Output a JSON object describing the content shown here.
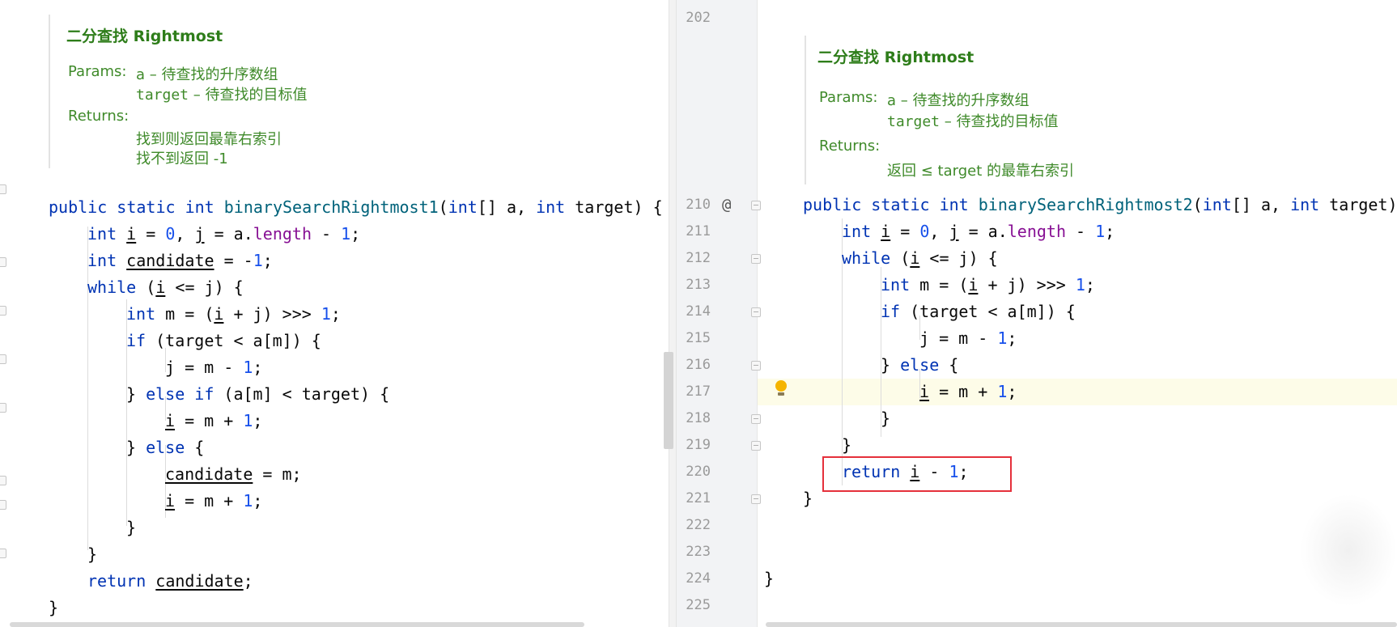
{
  "left": {
    "doc": {
      "title": "二分查找 Rightmost",
      "params_label": "Params:",
      "param_a_name": "a",
      "param_a_desc": " – 待查找的升序数组",
      "param_target_name": "target",
      "param_target_desc": " – 待查找的目标值",
      "returns_label": "Returns:",
      "returns_line1": "找到则返回最靠右索引",
      "returns_line2": "找不到返回 -1"
    },
    "code": {
      "l1": {
        "kw1": "public static int ",
        "fn": "binarySearchRightmost1",
        "p1": "(",
        "kw2": "int",
        "p2": "[] a, ",
        "kw3": "int",
        "p3": " target) {"
      },
      "l2": {
        "kw": "int ",
        "v1": "i",
        "p1": " = ",
        "n1": "0",
        "p2": ", ",
        "v2": "j",
        "p3": " = a.",
        "fld": "length",
        "p4": " - ",
        "n2": "1",
        "p5": ";"
      },
      "l3": {
        "kw": "int ",
        "v": "candidate",
        "p1": " = -",
        "n": "1",
        "p2": ";"
      },
      "l4": {
        "kw": "while",
        "p1": " (",
        "v": "i",
        "p2": " <= j) {"
      },
      "l5": {
        "kw": "int",
        "p1": " m = (",
        "v": "i",
        "p2": " + j) >>> ",
        "n": "1",
        "p3": ";"
      },
      "l6": {
        "kw": "if",
        "p1": " (target < a[m]) {"
      },
      "l7": {
        "p1": "j = m - ",
        "n": "1",
        "p2": ";"
      },
      "l8": {
        "p1": "} ",
        "kw": "else if",
        "p2": " (a[m] < target) {"
      },
      "l9": {
        "v": "i",
        "p1": " = m + ",
        "n": "1",
        "p2": ";"
      },
      "l10": {
        "p1": "} ",
        "kw": "else",
        "p2": " {"
      },
      "l11": {
        "v": "candidate",
        "p1": " = m;"
      },
      "l12": {
        "v": "i",
        "p1": " = m + ",
        "n": "1",
        "p2": ";"
      },
      "l13": {
        "p1": "}"
      },
      "l14": {
        "p1": "}"
      },
      "l15": {
        "kw": "return ",
        "v": "candidate",
        "p1": ";"
      },
      "l16": {
        "p1": "}"
      }
    }
  },
  "right": {
    "line_numbers": [
      "202",
      "210",
      "211",
      "212",
      "213",
      "214",
      "215",
      "216",
      "217",
      "218",
      "219",
      "220",
      "221",
      "222",
      "223",
      "224",
      "225"
    ],
    "override_marker": "@",
    "doc": {
      "title": "二分查找 Rightmost",
      "params_label": "Params:",
      "param_a_name": "a",
      "param_a_desc": " – 待查找的升序数组",
      "param_target_name": "target",
      "param_target_desc": " – 待查找的目标值",
      "returns_label": "Returns:",
      "returns_line1": "返回 ≤ target 的最靠右索引"
    },
    "code": {
      "l210": {
        "kw1": "public static int ",
        "fn": "binarySearchRightmost2",
        "p1": "(",
        "kw2": "int",
        "p2": "[] a, ",
        "kw3": "int",
        "p3": " target) {"
      },
      "l211": {
        "kw": "int ",
        "v1": "i",
        "p1": " = ",
        "n1": "0",
        "p2": ", ",
        "v2": "j",
        "p3": " = a.",
        "fld": "length",
        "p4": " - ",
        "n2": "1",
        "p5": ";"
      },
      "l212": {
        "kw": "while",
        "p1": " (",
        "v": "i",
        "p2": " <= j) {"
      },
      "l213": {
        "kw": "int",
        "p1": " m = (",
        "v": "i",
        "p2": " + j) >>> ",
        "n": "1",
        "p3": ";"
      },
      "l214": {
        "kw": "if",
        "p1": " (target < a[m]) {"
      },
      "l215": {
        "p1": "j = m - ",
        "n": "1",
        "p2": ";"
      },
      "l216": {
        "p1": "} ",
        "kw": "else",
        "p2": " {"
      },
      "l217": {
        "v": "i",
        "p1": " = m + ",
        "n": "1",
        "p2": ";"
      },
      "l218": {
        "p1": "}"
      },
      "l219": {
        "p1": "}"
      },
      "l220": {
        "kw": "return ",
        "v": "i",
        "p1": " - ",
        "n": "1",
        "p2": ";"
      },
      "l221": {
        "p1": "}"
      },
      "l224": {
        "p1": "}"
      }
    }
  },
  "colors": {
    "keyword": "#0033b3",
    "number": "#1750eb",
    "field": "#871094",
    "method": "#00627a",
    "doc": "#3f8a2a",
    "highlight_box": "#e5303b",
    "current_line": "#fdfce8"
  },
  "icons": {
    "intention_bulb": "lightbulb-icon",
    "fold_marker": "fold-icon"
  }
}
